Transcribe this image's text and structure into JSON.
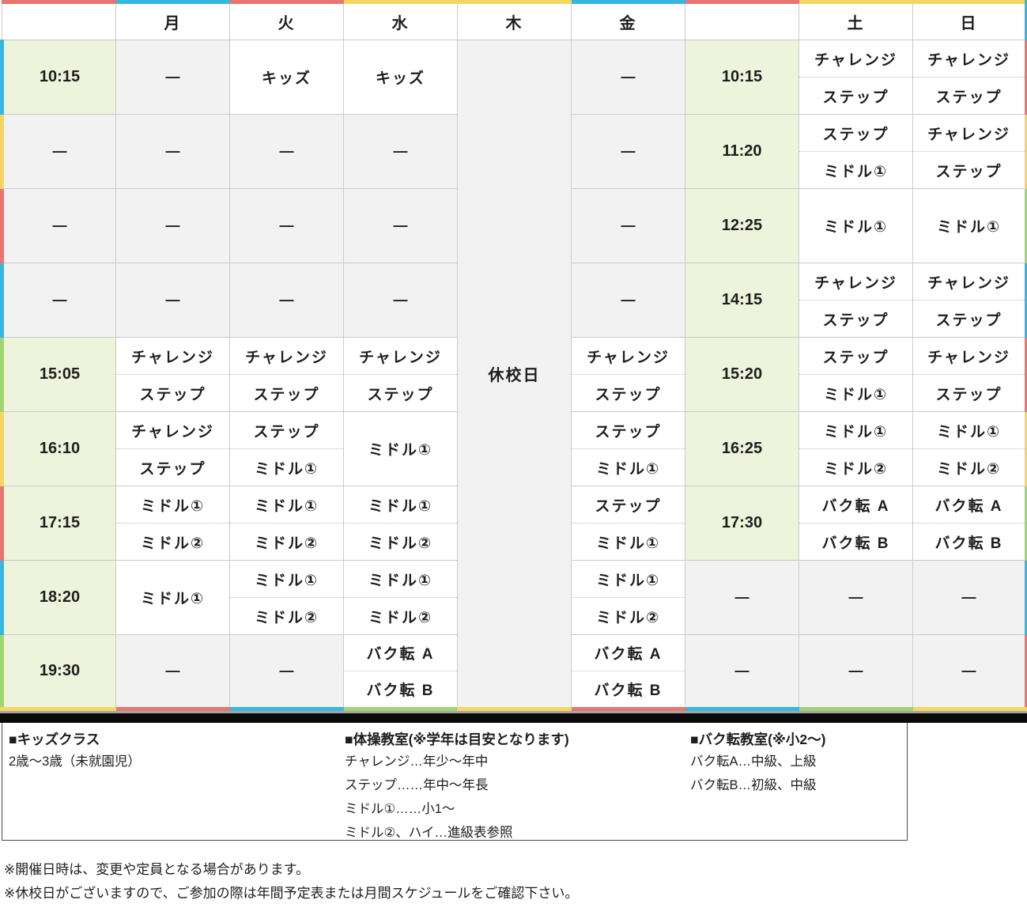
{
  "palette": {
    "cyan": "#35b7e0",
    "red": "#e8756f",
    "yellow": "#f5d662",
    "green": "#a3d473",
    "time_bg": "#eef3db",
    "empty_bg": "#f2f2f2"
  },
  "grid": {
    "header": [
      "",
      "月",
      "火",
      "水",
      "木",
      "金",
      "",
      "土",
      "日"
    ],
    "header_names": [
      "time-column-header-left",
      "day-header-mon",
      "day-header-tue",
      "day-header-wed",
      "day-header-thu",
      "day-header-fri",
      "time-column-header-right",
      "day-header-sat",
      "day-header-sun"
    ],
    "top_colors": [
      "red",
      "cyan",
      "red",
      "yellow",
      "yellow",
      "cyan",
      "red",
      "yellow",
      "yellow"
    ],
    "bottom_colors": [
      "yellow",
      "red",
      "cyan",
      "green",
      "yellow",
      "red",
      "cyan",
      "green",
      "yellow"
    ],
    "left_colors": [
      "cyan",
      "yellow",
      "red",
      "cyan",
      "green",
      "yellow",
      "red",
      "cyan",
      "green"
    ],
    "right_colors": [
      "red",
      "yellow",
      "green",
      "cyan",
      "red",
      "yellow",
      "green",
      "cyan",
      "red"
    ],
    "header_right_color": "cyan",
    "rows": [
      {
        "cells": [
          {
            "kind": "time",
            "text": "10:15"
          },
          {
            "kind": "empty",
            "text": "—"
          },
          {
            "kind": "single",
            "text": "キッズ"
          },
          {
            "kind": "single",
            "text": "キッズ"
          },
          {
            "kind": "closed",
            "text": "休校日",
            "rowspan": 9
          },
          {
            "kind": "empty",
            "text": "—"
          },
          {
            "kind": "time",
            "text": "10:15"
          },
          {
            "kind": "split",
            "top": "チャレンジ",
            "bottom": "ステップ"
          },
          {
            "kind": "split",
            "top": "チャレンジ",
            "bottom": "ステップ"
          }
        ]
      },
      {
        "cells": [
          {
            "kind": "timeempty",
            "text": "—"
          },
          {
            "kind": "empty",
            "text": "—"
          },
          {
            "kind": "empty",
            "text": "—"
          },
          {
            "kind": "empty",
            "text": "—"
          },
          {
            "kind": "empty",
            "text": "—"
          },
          {
            "kind": "time",
            "text": "11:20"
          },
          {
            "kind": "split",
            "top": "ステップ",
            "bottom": "ミドル①"
          },
          {
            "kind": "split",
            "top": "チャレンジ",
            "bottom": "ステップ"
          }
        ]
      },
      {
        "cells": [
          {
            "kind": "timeempty",
            "text": "—"
          },
          {
            "kind": "empty",
            "text": "—"
          },
          {
            "kind": "empty",
            "text": "—"
          },
          {
            "kind": "empty",
            "text": "—"
          },
          {
            "kind": "empty",
            "text": "—"
          },
          {
            "kind": "time",
            "text": "12:25"
          },
          {
            "kind": "single",
            "text": "ミドル①"
          },
          {
            "kind": "single",
            "text": "ミドル①"
          }
        ]
      },
      {
        "cells": [
          {
            "kind": "timeempty",
            "text": "—"
          },
          {
            "kind": "empty",
            "text": "—"
          },
          {
            "kind": "empty",
            "text": "—"
          },
          {
            "kind": "empty",
            "text": "—"
          },
          {
            "kind": "empty",
            "text": "—"
          },
          {
            "kind": "time",
            "text": "14:15"
          },
          {
            "kind": "split",
            "top": "チャレンジ",
            "bottom": "ステップ"
          },
          {
            "kind": "split",
            "top": "チャレンジ",
            "bottom": "ステップ"
          }
        ]
      },
      {
        "cells": [
          {
            "kind": "time",
            "text": "15:05"
          },
          {
            "kind": "split",
            "top": "チャレンジ",
            "bottom": "ステップ"
          },
          {
            "kind": "split",
            "top": "チャレンジ",
            "bottom": "ステップ"
          },
          {
            "kind": "split",
            "top": "チャレンジ",
            "bottom": "ステップ"
          },
          {
            "kind": "split",
            "top": "チャレンジ",
            "bottom": "ステップ"
          },
          {
            "kind": "time",
            "text": "15:20"
          },
          {
            "kind": "split",
            "top": "ステップ",
            "bottom": "ミドル①"
          },
          {
            "kind": "split",
            "top": "チャレンジ",
            "bottom": "ステップ"
          }
        ]
      },
      {
        "cells": [
          {
            "kind": "time",
            "text": "16:10"
          },
          {
            "kind": "split",
            "top": "チャレンジ",
            "bottom": "ステップ"
          },
          {
            "kind": "split",
            "top": "ステップ",
            "bottom": "ミドル①"
          },
          {
            "kind": "single",
            "text": "ミドル①"
          },
          {
            "kind": "split",
            "top": "ステップ",
            "bottom": "ミドル①"
          },
          {
            "kind": "time",
            "text": "16:25"
          },
          {
            "kind": "split",
            "top": "ミドル①",
            "bottom": "ミドル②"
          },
          {
            "kind": "split",
            "top": "ミドル①",
            "bottom": "ミドル②"
          }
        ]
      },
      {
        "cells": [
          {
            "kind": "time",
            "text": "17:15"
          },
          {
            "kind": "split",
            "top": "ミドル①",
            "bottom": "ミドル②"
          },
          {
            "kind": "split",
            "top": "ミドル①",
            "bottom": "ミドル②"
          },
          {
            "kind": "split",
            "top": "ミドル①",
            "bottom": "ミドル②"
          },
          {
            "kind": "split",
            "top": "ステップ",
            "bottom": "ミドル①"
          },
          {
            "kind": "time",
            "text": "17:30"
          },
          {
            "kind": "split",
            "top": "バク転 A",
            "bottom": "バク転 B"
          },
          {
            "kind": "split",
            "top": "バク転 A",
            "bottom": "バク転 B"
          }
        ]
      },
      {
        "cells": [
          {
            "kind": "time",
            "text": "18:20"
          },
          {
            "kind": "single",
            "text": "ミドル①"
          },
          {
            "kind": "split",
            "top": "ミドル①",
            "bottom": "ミドル②"
          },
          {
            "kind": "split",
            "top": "ミドル①",
            "bottom": "ミドル②"
          },
          {
            "kind": "split",
            "top": "ミドル①",
            "bottom": "ミドル②"
          },
          {
            "kind": "timeempty",
            "text": "—"
          },
          {
            "kind": "empty",
            "text": "—"
          },
          {
            "kind": "empty",
            "text": "—"
          }
        ]
      },
      {
        "cells": [
          {
            "kind": "time",
            "text": "19:30"
          },
          {
            "kind": "empty",
            "text": "—"
          },
          {
            "kind": "empty",
            "text": "—"
          },
          {
            "kind": "split",
            "top": "バク転 A",
            "bottom": "バク転 B"
          },
          {
            "kind": "split",
            "top": "バク転 A",
            "bottom": "バク転 B"
          },
          {
            "kind": "timeempty",
            "text": "—"
          },
          {
            "kind": "empty",
            "text": "—"
          },
          {
            "kind": "empty",
            "text": "—"
          }
        ]
      }
    ]
  },
  "legend": {
    "sections": [
      {
        "title": "■キッズクラス",
        "lines": [
          "2歳〜3歳（未就園児）"
        ]
      },
      {
        "title": "■体操教室(※学年は目安となります)",
        "lines": [
          "チャレンジ…年少〜年中",
          "ステップ……年中〜年長",
          "ミドル①……小1〜",
          "ミドル②、ハイ…進級表参照"
        ]
      },
      {
        "title": "■バク転教室(※小2〜)",
        "lines": [
          "バク転A…中級、上級",
          "バク転B…初級、中級"
        ]
      }
    ]
  },
  "notes": [
    "※開催日時は、変更や定員となる場合があります。",
    "※休校日がございますので、ご参加の際は年間予定表または月間スケジュールをご確認下さい。"
  ]
}
